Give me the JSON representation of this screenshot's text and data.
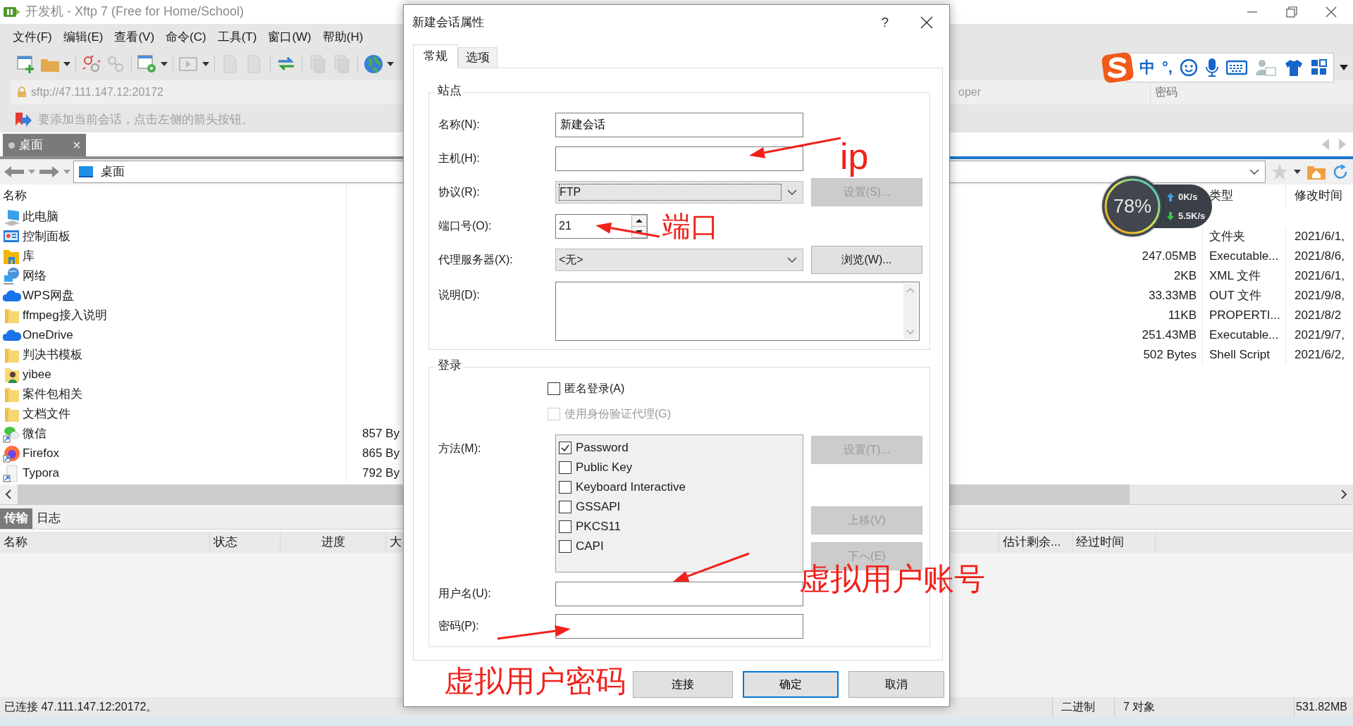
{
  "window": {
    "title": "开发机 - Xftp 7 (Free for Home/School)"
  },
  "menu": [
    "文件(F)",
    "编辑(E)",
    "查看(V)",
    "命令(C)",
    "工具(T)",
    "窗口(W)",
    "帮助(H)"
  ],
  "address_bar": {
    "url": "sftp://47.111.147.12:20172",
    "username": "oper",
    "password": {
      "placeholder": "密码"
    }
  },
  "hint": "要添加当前会话，点击左侧的箭头按钮。",
  "local_tabs": [
    {
      "label": "桌面",
      "selected": true
    }
  ],
  "local_path": "桌面",
  "local_list": {
    "columns": [
      "名称"
    ],
    "rows": [
      {
        "name": "此电脑",
        "kind": "computer"
      },
      {
        "name": "控制面板",
        "kind": "control-panel"
      },
      {
        "name": "库",
        "kind": "library"
      },
      {
        "name": "网络",
        "kind": "network"
      },
      {
        "name": "WPS网盘",
        "kind": "cloud"
      },
      {
        "name": "ffmpeg接入说明",
        "kind": "folder"
      },
      {
        "name": "OneDrive",
        "kind": "cloud"
      },
      {
        "name": "判决书模板",
        "kind": "folder"
      },
      {
        "name": "yibee",
        "kind": "user-folder"
      },
      {
        "name": "案件包相关",
        "kind": "folder"
      },
      {
        "name": "文档文件",
        "kind": "folder"
      },
      {
        "name": "微信",
        "kind": "chat-app",
        "size": "857 By"
      },
      {
        "name": "Firefox",
        "kind": "browser-app",
        "size": "865 By"
      },
      {
        "name": "Typora",
        "kind": "document-app",
        "size": "792 By"
      }
    ]
  },
  "remote_list": {
    "columns": [
      "类型",
      "修改时间"
    ],
    "rows": [
      {
        "type": "文件夹",
        "modified": "2021/6/1,"
      },
      {
        "size": "247.05MB",
        "type": "Executable...",
        "modified": "2021/8/6,"
      },
      {
        "size": "2KB",
        "type": "XML 文件",
        "modified": "2021/6/1,"
      },
      {
        "size": "33.33MB",
        "type": "OUT 文件",
        "modified": "2021/9/8,"
      },
      {
        "size": "11KB",
        "type": "PROPERTI...",
        "modified": "2021/8/2"
      },
      {
        "size": "251.43MB",
        "type": "Executable...",
        "modified": "2021/9/7,"
      },
      {
        "size": "502 Bytes",
        "type": "Shell Script",
        "modified": "2021/6/2,"
      }
    ]
  },
  "bottom_tabs": [
    {
      "label": "传输",
      "selected": true
    },
    {
      "label": "日志",
      "selected": false
    }
  ],
  "transfer_columns": [
    "名称",
    "状态",
    "进度",
    "大",
    "估计剩余...",
    "经过时间"
  ],
  "status_bar": {
    "connection": "已连接 47.111.147.12:20172。",
    "mode": "二进制",
    "count": "7 对象",
    "size": "531.82MB"
  },
  "ime_toolbar": {
    "mode": "中",
    "punctuation": "°,"
  },
  "speed_widget": {
    "percent": "78%",
    "upload": "0K/s",
    "download": "5.5K/s"
  },
  "dialog": {
    "title": "新建会话属性",
    "help": "?",
    "tabs": [
      {
        "label": "常规",
        "selected": true
      },
      {
        "label": "选项",
        "selected": false
      }
    ],
    "site": {
      "legend": "站点",
      "fields": [
        {
          "kind": "text",
          "label": "名称(N):",
          "value": "新建会话"
        },
        {
          "kind": "text",
          "label": "主机(H):"
        },
        {
          "kind": "combo",
          "label": "协议(R):",
          "value": "FTP",
          "button": {
            "label": "设置(S)...",
            "disabled": true
          }
        },
        {
          "kind": "spin",
          "label": "端口号(O):",
          "value": "21"
        },
        {
          "kind": "combo",
          "label": "代理服务器(X):",
          "value": "<无>",
          "button": {
            "label": "浏览(W)...",
            "disabled": false
          }
        },
        {
          "kind": "textarea",
          "label": "说明(D):"
        }
      ]
    },
    "login": {
      "legend": "登录",
      "options": [
        {
          "label": "匿名登录(A)",
          "checked": false,
          "disabled": false
        },
        {
          "label": "使用身份验证代理(G)",
          "checked": false,
          "disabled": true
        }
      ],
      "method_label": "方法(M):",
      "methods": [
        {
          "label": "Password",
          "checked": true
        },
        {
          "label": "Public Key",
          "checked": false
        },
        {
          "label": "Keyboard Interactive",
          "checked": false
        },
        {
          "label": "GSSAPI",
          "checked": false
        },
        {
          "label": "PKCS11",
          "checked": false
        },
        {
          "label": "CAPI",
          "checked": false
        }
      ],
      "method_buttons": [
        {
          "label": "设置(T)...",
          "disabled": true
        },
        {
          "label": "上移(V)",
          "disabled": true
        },
        {
          "label": "下へ(E)",
          "disabled": true
        }
      ],
      "username_label": "用户名(U):",
      "password_label": "密码(P):"
    },
    "buttons": [
      {
        "label": "连接",
        "default": false
      },
      {
        "label": "确定",
        "default": true
      },
      {
        "label": "取消",
        "default": false
      }
    ]
  },
  "annotations": [
    {
      "text": "ip"
    },
    {
      "text": "端口"
    },
    {
      "text": "虚拟用户账号"
    },
    {
      "text": "虚拟用户密码"
    }
  ]
}
